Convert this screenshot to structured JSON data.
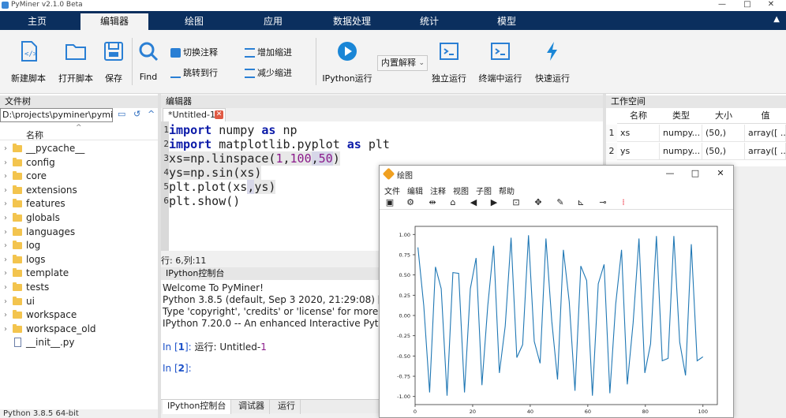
{
  "window": {
    "title": "PyMiner v2.1.0 Beta",
    "minimize": "—",
    "maximize": "□",
    "close": "✕"
  },
  "tabs": [
    {
      "label": "主页"
    },
    {
      "label": "编辑器"
    },
    {
      "label": "绘图"
    },
    {
      "label": "应用"
    },
    {
      "label": "数据处理"
    },
    {
      "label": "统计"
    },
    {
      "label": "模型"
    }
  ],
  "active_tab": "编辑器",
  "ribbon": {
    "new_script": "新建脚本",
    "open_script": "打开脚本",
    "save": "保存",
    "find": "Find",
    "toggle_comment": "切换注释",
    "goto_line": "跳转到行",
    "add_indent": "增加缩进",
    "reduce_indent": "减少缩进",
    "ipython_run": "IPython运行",
    "interpreter": "内置解释",
    "run_standalone": "独立运行",
    "run_terminal": "终端中运行",
    "quick_run": "快速运行"
  },
  "filetree": {
    "header": "文件树",
    "path": "D:\\projects\\pyminer\\pymin",
    "column_name": "名称",
    "items": [
      {
        "name": "__pycache__",
        "type": "folder"
      },
      {
        "name": "config",
        "type": "folder"
      },
      {
        "name": "core",
        "type": "folder"
      },
      {
        "name": "extensions",
        "type": "folder"
      },
      {
        "name": "features",
        "type": "folder"
      },
      {
        "name": "globals",
        "type": "folder"
      },
      {
        "name": "languages",
        "type": "folder"
      },
      {
        "name": "log",
        "type": "folder"
      },
      {
        "name": "logs",
        "type": "folder"
      },
      {
        "name": "template",
        "type": "folder"
      },
      {
        "name": "tests",
        "type": "folder"
      },
      {
        "name": "ui",
        "type": "folder"
      },
      {
        "name": "workspace",
        "type": "folder"
      },
      {
        "name": "workspace_old",
        "type": "folder"
      },
      {
        "name": "__init__.py",
        "type": "file"
      }
    ]
  },
  "editor": {
    "header": "编辑器",
    "tab": "*Untitled-1",
    "line_numbers": [
      "1",
      "2",
      "3",
      "4",
      "5",
      "6"
    ],
    "status": "行: 6,列:11",
    "code": {
      "l1": {
        "kw1": "import",
        "t1": " numpy ",
        "kw2": "as",
        "t2": " np"
      },
      "l2": {
        "kw1": "import",
        "t1": " matplotlib.pyplot ",
        "kw2": "as",
        "t2": " plt"
      },
      "l3": {
        "t1": "xs=np.linspace(",
        "n1": "1",
        "c1": ",",
        "n2": "100",
        "c2": ",",
        "n3": "50",
        "t2": ")"
      },
      "l4": {
        "t1": "ys=np.sin(xs)"
      },
      "l5": {
        "t1": "plt.plot(xs",
        "c1": ",",
        "t2": "ys)"
      },
      "l6": {
        "t1": "plt.show()"
      }
    }
  },
  "console": {
    "header": "IPython控制台",
    "lines": [
      "Welcome To PyMiner!",
      "Python 3.8.5 (default, Sep  3 2020, 21:29:08) [MSC v",
      "Type 'copyright', 'credits' or 'license' for more infor",
      "IPython 7.20.0 -- An enhanced Interactive Python. Ty"
    ],
    "prompt1": {
      "in": "In [",
      "n": "1",
      "close": "]: ",
      "cmd": "运行:  Untitled-",
      "arg": "1"
    },
    "prompt2": {
      "in": "In [",
      "n": "2",
      "close": "]: "
    },
    "bottom_tabs": [
      "IPython控制台",
      "调试器",
      "运行"
    ]
  },
  "workspace": {
    "header": "工作空间",
    "columns": [
      "名称",
      "类型",
      "大小",
      "值"
    ],
    "rows": [
      {
        "index": "1",
        "name": "xs",
        "type": "numpy...",
        "size": "(50,)",
        "value": "array([ ..."
      },
      {
        "index": "2",
        "name": "ys",
        "type": "numpy...",
        "size": "(50,)",
        "value": "array([ ..."
      }
    ]
  },
  "status_bar": "Python 3.8.5 64-bit",
  "plot_window": {
    "title": "绘图",
    "menu": [
      "文件",
      "编辑",
      "注释",
      "视图",
      "子图",
      "帮助"
    ],
    "toolbar_icons": [
      "save-icon",
      "settings-icon",
      "adjust-icon",
      "home-icon",
      "back-icon",
      "forward-icon",
      "zoom-rect-icon",
      "pan-icon",
      "brush-icon",
      "axes-icon",
      "marker-icon",
      "palette-icon"
    ]
  },
  "chart_data": {
    "type": "line",
    "color": "#1f77b4",
    "xlim": [
      1,
      100
    ],
    "ylim": [
      -1.0,
      1.0
    ],
    "x_ticks": [
      0,
      20,
      40,
      60,
      80,
      100
    ],
    "y_ticks": [
      -1.0,
      -0.75,
      -0.5,
      -0.25,
      0.0,
      0.25,
      0.5,
      0.75,
      1.0
    ],
    "series": [
      {
        "x": [
          1,
          3.02,
          5.04,
          7.06,
          9.08,
          11.1,
          13.12,
          15.14,
          17.16,
          19.18,
          21.2,
          23.22,
          25.24,
          27.27,
          29.29,
          31.31,
          33.33,
          35.35,
          37.37,
          39.39,
          41.41,
          43.43,
          45.45,
          47.47,
          49.49,
          51.51,
          53.53,
          55.55,
          57.57,
          59.59,
          61.61,
          63.63,
          65.65,
          67.67,
          69.69,
          71.71,
          73.73,
          75.76,
          77.78,
          79.8,
          81.82,
          83.84,
          85.86,
          87.88,
          89.9,
          91.92,
          93.94,
          95.96,
          97.98,
          100
        ],
        "y": [
          0.84,
          0.12,
          -0.95,
          0.6,
          0.33,
          -0.99,
          0.53,
          0.52,
          -0.95,
          0.33,
          0.71,
          -0.86,
          0.12,
          0.86,
          -0.71,
          -0.13,
          0.96,
          -0.52,
          -0.36,
          0.99,
          -0.32,
          -0.59,
          0.95,
          -0.07,
          -0.79,
          0.81,
          0.17,
          -0.93,
          0.61,
          0.43,
          -0.99,
          0.39,
          0.63,
          -0.96,
          0.14,
          0.81,
          -0.85,
          -0.09,
          0.95,
          -0.71,
          -0.35,
          0.98,
          -0.56,
          -0.53,
          0.98,
          -0.33,
          -0.74,
          0.88,
          -0.56,
          -0.51
        ]
      }
    ]
  }
}
